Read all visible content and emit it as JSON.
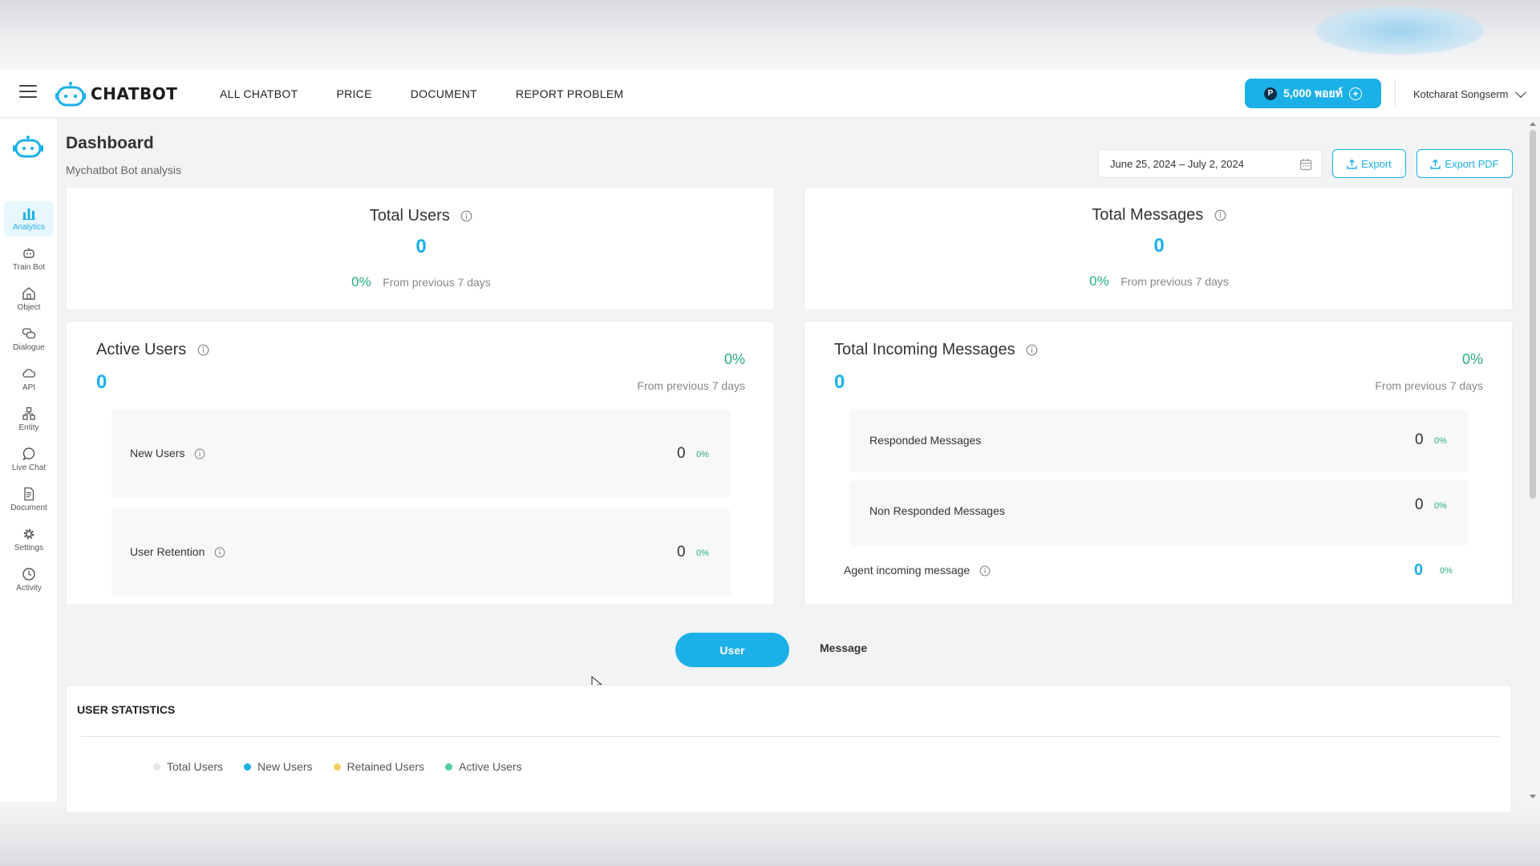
{
  "nav": {
    "logo_text": "CHATBOT",
    "links": [
      "ALL CHATBOT",
      "PRICE",
      "DOCUMENT",
      "REPORT PROBLEM"
    ],
    "points_label": "5,000 พอยท์",
    "user_name": "Kotcharat Songserm"
  },
  "sidebar": {
    "items": [
      {
        "label": "Analytics",
        "icon": "bar-chart-icon"
      },
      {
        "label": "Train Bot",
        "icon": "robot-icon"
      },
      {
        "label": "Object",
        "icon": "building-icon"
      },
      {
        "label": "Dialogue",
        "icon": "chat-bubbles-icon"
      },
      {
        "label": "API",
        "icon": "cloud-icon"
      },
      {
        "label": "Entity",
        "icon": "nodes-icon"
      },
      {
        "label": "Live Chat",
        "icon": "chat-icon"
      },
      {
        "label": "Document",
        "icon": "document-icon"
      },
      {
        "label": "Settings",
        "icon": "gear-icon"
      },
      {
        "label": "Activity",
        "icon": "clock-icon"
      }
    ]
  },
  "header": {
    "title": "Dashboard",
    "subtitle": "Mychatbot Bot analysis",
    "date_range": "June 25, 2024 – July 2, 2024",
    "export_label": "Export",
    "export_pdf_label": "Export PDF"
  },
  "total_users": {
    "title": "Total Users",
    "value": "0",
    "pct": "0%",
    "note": "From previous 7 days"
  },
  "total_messages": {
    "title": "Total Messages",
    "value": "0",
    "pct": "0%",
    "note": "From previous 7 days"
  },
  "active_users": {
    "title": "Active Users",
    "value": "0",
    "pct": "0%",
    "note": "From previous 7 days",
    "new_users": {
      "label": "New Users",
      "value": "0",
      "pct": "0%"
    },
    "user_retention": {
      "label": "User Retention",
      "value": "0",
      "pct": "0%"
    }
  },
  "incoming": {
    "title": "Total Incoming Messages",
    "value": "0",
    "pct": "0%",
    "note": "From previous 7 days",
    "responded": {
      "label": "Responded Messages",
      "value": "0",
      "pct": "0%"
    },
    "non_responded": {
      "label": "Non Responded Messages",
      "value": "0",
      "pct": "0%"
    },
    "agent": {
      "label": "Agent incoming message",
      "value": "0",
      "pct": "0%"
    }
  },
  "toggle": {
    "user": "User",
    "message": "Message"
  },
  "stats": {
    "title": "USER STATISTICS",
    "legend": [
      {
        "label": "Total Users",
        "color": "#e6e6e6"
      },
      {
        "label": "New Users",
        "color": "#1bb0e8"
      },
      {
        "label": "Retained Users",
        "color": "#f2cf63"
      },
      {
        "label": "Active Users",
        "color": "#4fcfa2"
      }
    ]
  },
  "colors": {
    "accent": "#1bb0e8",
    "positive": "#27b07a"
  }
}
